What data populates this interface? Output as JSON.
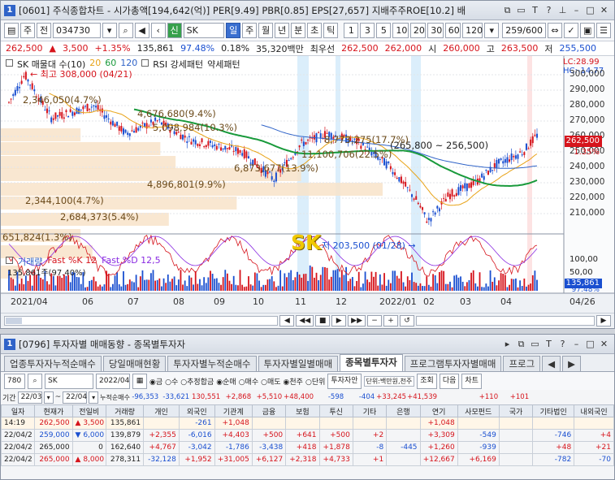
{
  "window1": {
    "title": "[0601] 주식종합차트 - 시가총액[194,642(억)] PER[9.49] PBR[0.85] EPS[27,657] 지배주주ROE[10.2] 배",
    "num": "1",
    "toolbar": {
      "code": "034730",
      "name": "SK",
      "periods": [
        "일",
        "주",
        "월",
        "년",
        "분",
        "초",
        "틱"
      ],
      "numbers": [
        "1",
        "3",
        "5",
        "10",
        "20",
        "30",
        "60",
        "120"
      ],
      "counter": "259/600",
      "left_btns": [
        "주",
        "전"
      ],
      "credit": "신"
    },
    "price": {
      "current": "262,500",
      "change": "3,500",
      "rate": "+1.35%",
      "volume": "135,861",
      "ratio": "97.48%",
      "turnover": "0.18%",
      "amount": "35,320백만",
      "best": "최우선",
      "best_price": "262,500",
      "open_label": "시",
      "open_prev": "262,000",
      "open": "260,000",
      "high_label": "고",
      "high": "263,500",
      "low_label": "저",
      "low": "255,500"
    },
    "chart_legend": {
      "ma": "SK 매물대 수(10)",
      "m20": "20",
      "m60": "60",
      "m120": "120",
      "rsi": "RSI 강세패턴",
      "weak": "약세패턴"
    },
    "annotations": {
      "high": "최고 308,000 (04/21)",
      "low": "저 203,500 (01/28)",
      "lc": "LC:28.99",
      "hc": "HC:-14.77",
      "current_tag": "262,500",
      "current_pct": "1.35%",
      "logo": "SK",
      "range": "265,800 ~ 256,500"
    },
    "volume_profile": [
      "2,346,050(4.7%)",
      "4,676,680(9.4%)",
      "5,098,984(10.3%)",
      "8,773,275(17.7%)",
      "11,100,706(22.5%)",
      "6,873,677(13.9%)",
      "4,896,801(9.9%)",
      "2,344,100(4.7%)",
      "2,684,373(5.4%)",
      "651,824(1.3%)"
    ],
    "y_axis": [
      "300,000",
      "290,000",
      "280,000",
      "270,000",
      "260,000",
      "250,000",
      "240,000",
      "230,000",
      "220,000",
      "210,000"
    ],
    "sub": {
      "volume": "거래량",
      "fastk": "Fast %K 12",
      "fastd": "Fast %D 12,5",
      "vol_value": "135,861주(97.40%)",
      "y_top": "100,00",
      "y_mid": "50,00",
      "vol_tag": "135,861",
      "pct_tag": "97.48%"
    },
    "x_axis": [
      "2021/04",
      "06",
      "07",
      "08",
      "09",
      "10",
      "11",
      "12",
      "2022/01",
      "02",
      "03",
      "04",
      "04/26"
    ]
  },
  "window2": {
    "num": "1",
    "title": "[0796] 투자자별 매매동향 - 종목별투자자",
    "tabs": [
      "업종투자자누적순매수",
      "당일매매현황",
      "투자자별누적순매수",
      "투자자별일별매매",
      "종목별투자자",
      "프로그램투자자별매매",
      "프로그"
    ],
    "controls": {
      "code": "780",
      "name": "SK",
      "date": "2022/04",
      "radios": [
        "금",
        "수",
        "추정합금",
        "순매",
        "매수",
        "매도"
      ],
      "radio2": [
        "천주",
        "단위"
      ],
      "btn1": "투자자안",
      "note": "단위:백만원,천주",
      "btn2": "조회",
      "btn3": "다음",
      "btn4": "차트"
    },
    "period": {
      "label": "기간",
      "from": "22/03",
      "to": "22/04",
      "sum_label": "누적순매수"
    },
    "sum_row": [
      "-96,353",
      "-33,621",
      "130,551",
      "+2,868",
      "+5,510",
      "+48,400",
      "-598",
      "-404",
      "+33,245",
      "+41,539",
      "",
      "+110",
      "+101"
    ],
    "headers": [
      "일자",
      "현재가",
      "전일비",
      "거래량",
      "개인",
      "외국인",
      "기관계",
      "금융",
      "보험",
      "투신",
      "기타",
      "은행",
      "연기",
      "사모펀드",
      "국가",
      "기타법인",
      "내외국인"
    ],
    "rows": [
      [
        "14:19",
        "262,500",
        "3,500",
        "135,861",
        "",
        "-261",
        "+1,048",
        "",
        "",
        "",
        "",
        "",
        "+1,048",
        "",
        "",
        "",
        ""
      ],
      [
        "22/04/2",
        "259,000",
        "6,000",
        "139,879",
        "+2,355",
        "-6,016",
        "+4,403",
        "+500",
        "+641",
        "+500",
        "+2",
        "",
        "+3,309",
        "-549",
        "",
        "-746",
        "+4"
      ],
      [
        "22/04/2",
        "265,000",
        "0",
        "162,640",
        "+4,767",
        "-3,042",
        "-1,786",
        "-3,438",
        "+418",
        "+1,878",
        "-8",
        "-445",
        "+1,260",
        "-939",
        "",
        "+48",
        "+21"
      ],
      [
        "22/04/2",
        "265,000",
        "8,000",
        "278,311",
        "-32,128",
        "+1,952",
        "+31,005",
        "+6,127",
        "+2,318",
        "+4,733",
        "+1",
        "",
        "+12,667",
        "+6,169",
        "",
        "-782",
        "-70"
      ]
    ]
  }
}
